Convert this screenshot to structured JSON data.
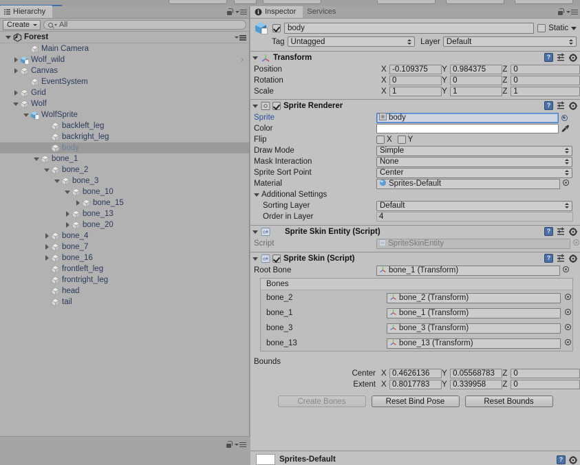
{
  "hierarchy": {
    "tab_label": "Hierarchy",
    "tab_icon": "hierarchy-icon",
    "create_label": "Create",
    "search_placeholder": "All",
    "search_value": "All",
    "scene_name": "Forest",
    "items": [
      {
        "label": "Main Camera",
        "depth": 2,
        "expand": "none",
        "icon": "gameobject-icon",
        "selected": false
      },
      {
        "label": "Wolf_wild",
        "depth": 1,
        "expand": "collapsed",
        "icon": "prefab-icon",
        "selected": false,
        "prefab": true,
        "hasArrow": true
      },
      {
        "label": "Canvas",
        "depth": 1,
        "expand": "collapsed",
        "icon": "gameobject-icon",
        "selected": false
      },
      {
        "label": "EventSystem",
        "depth": 2,
        "expand": "none",
        "icon": "gameobject-icon",
        "selected": false
      },
      {
        "label": "Grid",
        "depth": 1,
        "expand": "collapsed",
        "icon": "gameobject-icon",
        "selected": false
      },
      {
        "label": "Wolf",
        "depth": 1,
        "expand": "expanded",
        "icon": "gameobject-icon",
        "selected": false
      },
      {
        "label": "WolfSprite",
        "depth": 2,
        "expand": "expanded",
        "icon": "prefab-icon",
        "selected": false,
        "prefab": true
      },
      {
        "label": "backleft_leg",
        "depth": 4,
        "expand": "none",
        "icon": "gameobject-icon",
        "selected": false
      },
      {
        "label": "backright_leg",
        "depth": 4,
        "expand": "none",
        "icon": "gameobject-icon",
        "selected": false
      },
      {
        "label": "body",
        "depth": 4,
        "expand": "none",
        "icon": "gameobject-icon",
        "selected": true
      },
      {
        "label": "bone_1",
        "depth": 3,
        "expand": "expanded",
        "icon": "gameobject-icon",
        "selected": false
      },
      {
        "label": "bone_2",
        "depth": 4,
        "expand": "expanded",
        "icon": "gameobject-icon",
        "selected": false
      },
      {
        "label": "bone_3",
        "depth": 5,
        "expand": "expanded",
        "icon": "gameobject-icon",
        "selected": false
      },
      {
        "label": "bone_10",
        "depth": 6,
        "expand": "expanded",
        "icon": "gameobject-icon",
        "selected": false
      },
      {
        "label": "bone_15",
        "depth": 7,
        "expand": "collapsed",
        "icon": "gameobject-icon",
        "selected": false
      },
      {
        "label": "bone_13",
        "depth": 6,
        "expand": "collapsed",
        "icon": "gameobject-icon",
        "selected": false
      },
      {
        "label": "bone_20",
        "depth": 6,
        "expand": "collapsed",
        "icon": "gameobject-icon",
        "selected": false
      },
      {
        "label": "bone_4",
        "depth": 4,
        "expand": "collapsed",
        "icon": "gameobject-icon",
        "selected": false
      },
      {
        "label": "bone_7",
        "depth": 4,
        "expand": "collapsed",
        "icon": "gameobject-icon",
        "selected": false
      },
      {
        "label": "bone_16",
        "depth": 4,
        "expand": "collapsed",
        "icon": "gameobject-icon",
        "selected": false
      },
      {
        "label": "frontleft_leg",
        "depth": 4,
        "expand": "none",
        "icon": "gameobject-icon",
        "selected": false
      },
      {
        "label": "frontright_leg",
        "depth": 4,
        "expand": "none",
        "icon": "gameobject-icon",
        "selected": false
      },
      {
        "label": "head",
        "depth": 4,
        "expand": "none",
        "icon": "gameobject-icon",
        "selected": false
      },
      {
        "label": "tail",
        "depth": 4,
        "expand": "none",
        "icon": "gameobject-icon",
        "selected": false
      }
    ]
  },
  "inspector": {
    "tabs": [
      {
        "label": "Inspector",
        "active": true,
        "icon": "info-icon"
      },
      {
        "label": "Services",
        "active": false,
        "icon": ""
      }
    ],
    "gameobject": {
      "enabled": true,
      "name": "body",
      "static_label": "Static",
      "static_checked": false,
      "tag_label": "Tag",
      "tag_value": "Untagged",
      "layer_label": "Layer",
      "layer_value": "Default"
    },
    "transform": {
      "title": "Transform",
      "icon": "transform-icon",
      "rows": [
        {
          "name": "Position",
          "x": "-0.109375",
          "y": "0.984375",
          "z": "0"
        },
        {
          "name": "Rotation",
          "x": "0",
          "y": "0",
          "z": "0"
        },
        {
          "name": "Scale",
          "x": "1",
          "y": "1",
          "z": "1"
        }
      ],
      "axes": [
        "X",
        "Y",
        "Z"
      ]
    },
    "sprite_renderer": {
      "title": "Sprite Renderer",
      "icon": "sprite-renderer-icon",
      "enabled": true,
      "sprite_label": "Sprite",
      "sprite_value": "body",
      "color_label": "Color",
      "flip_label": "Flip",
      "flip_x_label": "X",
      "flip_y_label": "Y",
      "flip_x": false,
      "flip_y": false,
      "draw_mode_label": "Draw Mode",
      "draw_mode_value": "Simple",
      "mask_interaction_label": "Mask Interaction",
      "mask_interaction_value": "None",
      "sort_point_label": "Sprite Sort Point",
      "sort_point_value": "Center",
      "material_label": "Material",
      "material_value": "Sprites-Default",
      "additional_settings_label": "Additional Settings",
      "sorting_layer_label": "Sorting Layer",
      "sorting_layer_value": "Default",
      "order_in_layer_label": "Order in Layer",
      "order_in_layer_value": "4"
    },
    "sprite_skin_entity": {
      "title": "Sprite Skin Entity (Script)",
      "icon": "cs-script-icon",
      "script_label": "Script",
      "script_value": "SpriteSkinEntity"
    },
    "sprite_skin": {
      "title": "Sprite Skin (Script)",
      "icon": "cs-script-icon",
      "enabled": true,
      "root_bone_label": "Root Bone",
      "root_bone_value": "bone_1 (Transform)",
      "bones_header": "Bones",
      "bones": [
        {
          "name": "bone_2",
          "value": "bone_2 (Transform)"
        },
        {
          "name": "bone_1",
          "value": "bone_1 (Transform)"
        },
        {
          "name": "bone_3",
          "value": "bone_3 (Transform)"
        },
        {
          "name": "bone_13",
          "value": "bone_13 (Transform)"
        }
      ],
      "bounds_label": "Bounds",
      "bounds": [
        {
          "name": "Center",
          "x": "0.4626136",
          "y": "0.05568783",
          "z": "0"
        },
        {
          "name": "Extent",
          "x": "0.8017783",
          "y": "0.339958",
          "z": "0"
        }
      ],
      "axes": [
        "X",
        "Y",
        "Z"
      ],
      "buttons": [
        {
          "label": "Create Bones",
          "disabled": true
        },
        {
          "label": "Reset Bind Pose",
          "disabled": false
        },
        {
          "label": "Reset Bounds",
          "disabled": false
        }
      ]
    },
    "material_footer": {
      "title": "Sprites-Default"
    }
  },
  "colors": {
    "panel_bg": "#c2c2c2",
    "hierarchy_bg": "#b2b2b2",
    "tabbar_bg": "#a5a5a5",
    "selection": "#9a9a9a",
    "link_text": "#29395c",
    "accent_blue": "#3d6ea5",
    "prefab_blue": "#5a8fd0"
  }
}
